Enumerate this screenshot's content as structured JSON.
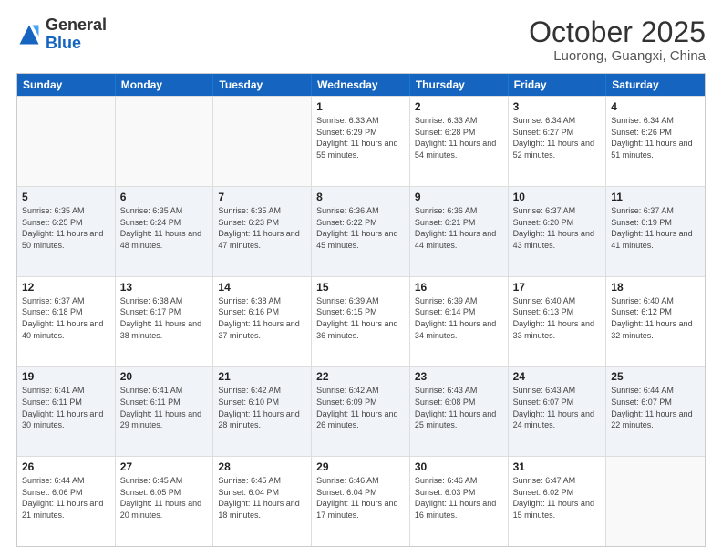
{
  "header": {
    "logo_general": "General",
    "logo_blue": "Blue",
    "month_title": "October 2025",
    "location": "Luorong, Guangxi, China"
  },
  "days_of_week": [
    "Sunday",
    "Monday",
    "Tuesday",
    "Wednesday",
    "Thursday",
    "Friday",
    "Saturday"
  ],
  "weeks": [
    [
      {
        "day": "",
        "empty": true
      },
      {
        "day": "",
        "empty": true
      },
      {
        "day": "",
        "empty": true
      },
      {
        "day": "1",
        "sunrise": "6:33 AM",
        "sunset": "6:29 PM",
        "daylight": "11 hours and 55 minutes."
      },
      {
        "day": "2",
        "sunrise": "6:33 AM",
        "sunset": "6:28 PM",
        "daylight": "11 hours and 54 minutes."
      },
      {
        "day": "3",
        "sunrise": "6:34 AM",
        "sunset": "6:27 PM",
        "daylight": "11 hours and 52 minutes."
      },
      {
        "day": "4",
        "sunrise": "6:34 AM",
        "sunset": "6:26 PM",
        "daylight": "11 hours and 51 minutes."
      }
    ],
    [
      {
        "day": "5",
        "sunrise": "6:35 AM",
        "sunset": "6:25 PM",
        "daylight": "11 hours and 50 minutes."
      },
      {
        "day": "6",
        "sunrise": "6:35 AM",
        "sunset": "6:24 PM",
        "daylight": "11 hours and 48 minutes."
      },
      {
        "day": "7",
        "sunrise": "6:35 AM",
        "sunset": "6:23 PM",
        "daylight": "11 hours and 47 minutes."
      },
      {
        "day": "8",
        "sunrise": "6:36 AM",
        "sunset": "6:22 PM",
        "daylight": "11 hours and 45 minutes."
      },
      {
        "day": "9",
        "sunrise": "6:36 AM",
        "sunset": "6:21 PM",
        "daylight": "11 hours and 44 minutes."
      },
      {
        "day": "10",
        "sunrise": "6:37 AM",
        "sunset": "6:20 PM",
        "daylight": "11 hours and 43 minutes."
      },
      {
        "day": "11",
        "sunrise": "6:37 AM",
        "sunset": "6:19 PM",
        "daylight": "11 hours and 41 minutes."
      }
    ],
    [
      {
        "day": "12",
        "sunrise": "6:37 AM",
        "sunset": "6:18 PM",
        "daylight": "11 hours and 40 minutes."
      },
      {
        "day": "13",
        "sunrise": "6:38 AM",
        "sunset": "6:17 PM",
        "daylight": "11 hours and 38 minutes."
      },
      {
        "day": "14",
        "sunrise": "6:38 AM",
        "sunset": "6:16 PM",
        "daylight": "11 hours and 37 minutes."
      },
      {
        "day": "15",
        "sunrise": "6:39 AM",
        "sunset": "6:15 PM",
        "daylight": "11 hours and 36 minutes."
      },
      {
        "day": "16",
        "sunrise": "6:39 AM",
        "sunset": "6:14 PM",
        "daylight": "11 hours and 34 minutes."
      },
      {
        "day": "17",
        "sunrise": "6:40 AM",
        "sunset": "6:13 PM",
        "daylight": "11 hours and 33 minutes."
      },
      {
        "day": "18",
        "sunrise": "6:40 AM",
        "sunset": "6:12 PM",
        "daylight": "11 hours and 32 minutes."
      }
    ],
    [
      {
        "day": "19",
        "sunrise": "6:41 AM",
        "sunset": "6:11 PM",
        "daylight": "11 hours and 30 minutes."
      },
      {
        "day": "20",
        "sunrise": "6:41 AM",
        "sunset": "6:11 PM",
        "daylight": "11 hours and 29 minutes."
      },
      {
        "day": "21",
        "sunrise": "6:42 AM",
        "sunset": "6:10 PM",
        "daylight": "11 hours and 28 minutes."
      },
      {
        "day": "22",
        "sunrise": "6:42 AM",
        "sunset": "6:09 PM",
        "daylight": "11 hours and 26 minutes."
      },
      {
        "day": "23",
        "sunrise": "6:43 AM",
        "sunset": "6:08 PM",
        "daylight": "11 hours and 25 minutes."
      },
      {
        "day": "24",
        "sunrise": "6:43 AM",
        "sunset": "6:07 PM",
        "daylight": "11 hours and 24 minutes."
      },
      {
        "day": "25",
        "sunrise": "6:44 AM",
        "sunset": "6:07 PM",
        "daylight": "11 hours and 22 minutes."
      }
    ],
    [
      {
        "day": "26",
        "sunrise": "6:44 AM",
        "sunset": "6:06 PM",
        "daylight": "11 hours and 21 minutes."
      },
      {
        "day": "27",
        "sunrise": "6:45 AM",
        "sunset": "6:05 PM",
        "daylight": "11 hours and 20 minutes."
      },
      {
        "day": "28",
        "sunrise": "6:45 AM",
        "sunset": "6:04 PM",
        "daylight": "11 hours and 18 minutes."
      },
      {
        "day": "29",
        "sunrise": "6:46 AM",
        "sunset": "6:04 PM",
        "daylight": "11 hours and 17 minutes."
      },
      {
        "day": "30",
        "sunrise": "6:46 AM",
        "sunset": "6:03 PM",
        "daylight": "11 hours and 16 minutes."
      },
      {
        "day": "31",
        "sunrise": "6:47 AM",
        "sunset": "6:02 PM",
        "daylight": "11 hours and 15 minutes."
      },
      {
        "day": "",
        "empty": true
      }
    ]
  ],
  "labels": {
    "sunrise_prefix": "Sunrise: ",
    "sunset_prefix": "Sunset: ",
    "daylight_prefix": "Daylight: "
  }
}
